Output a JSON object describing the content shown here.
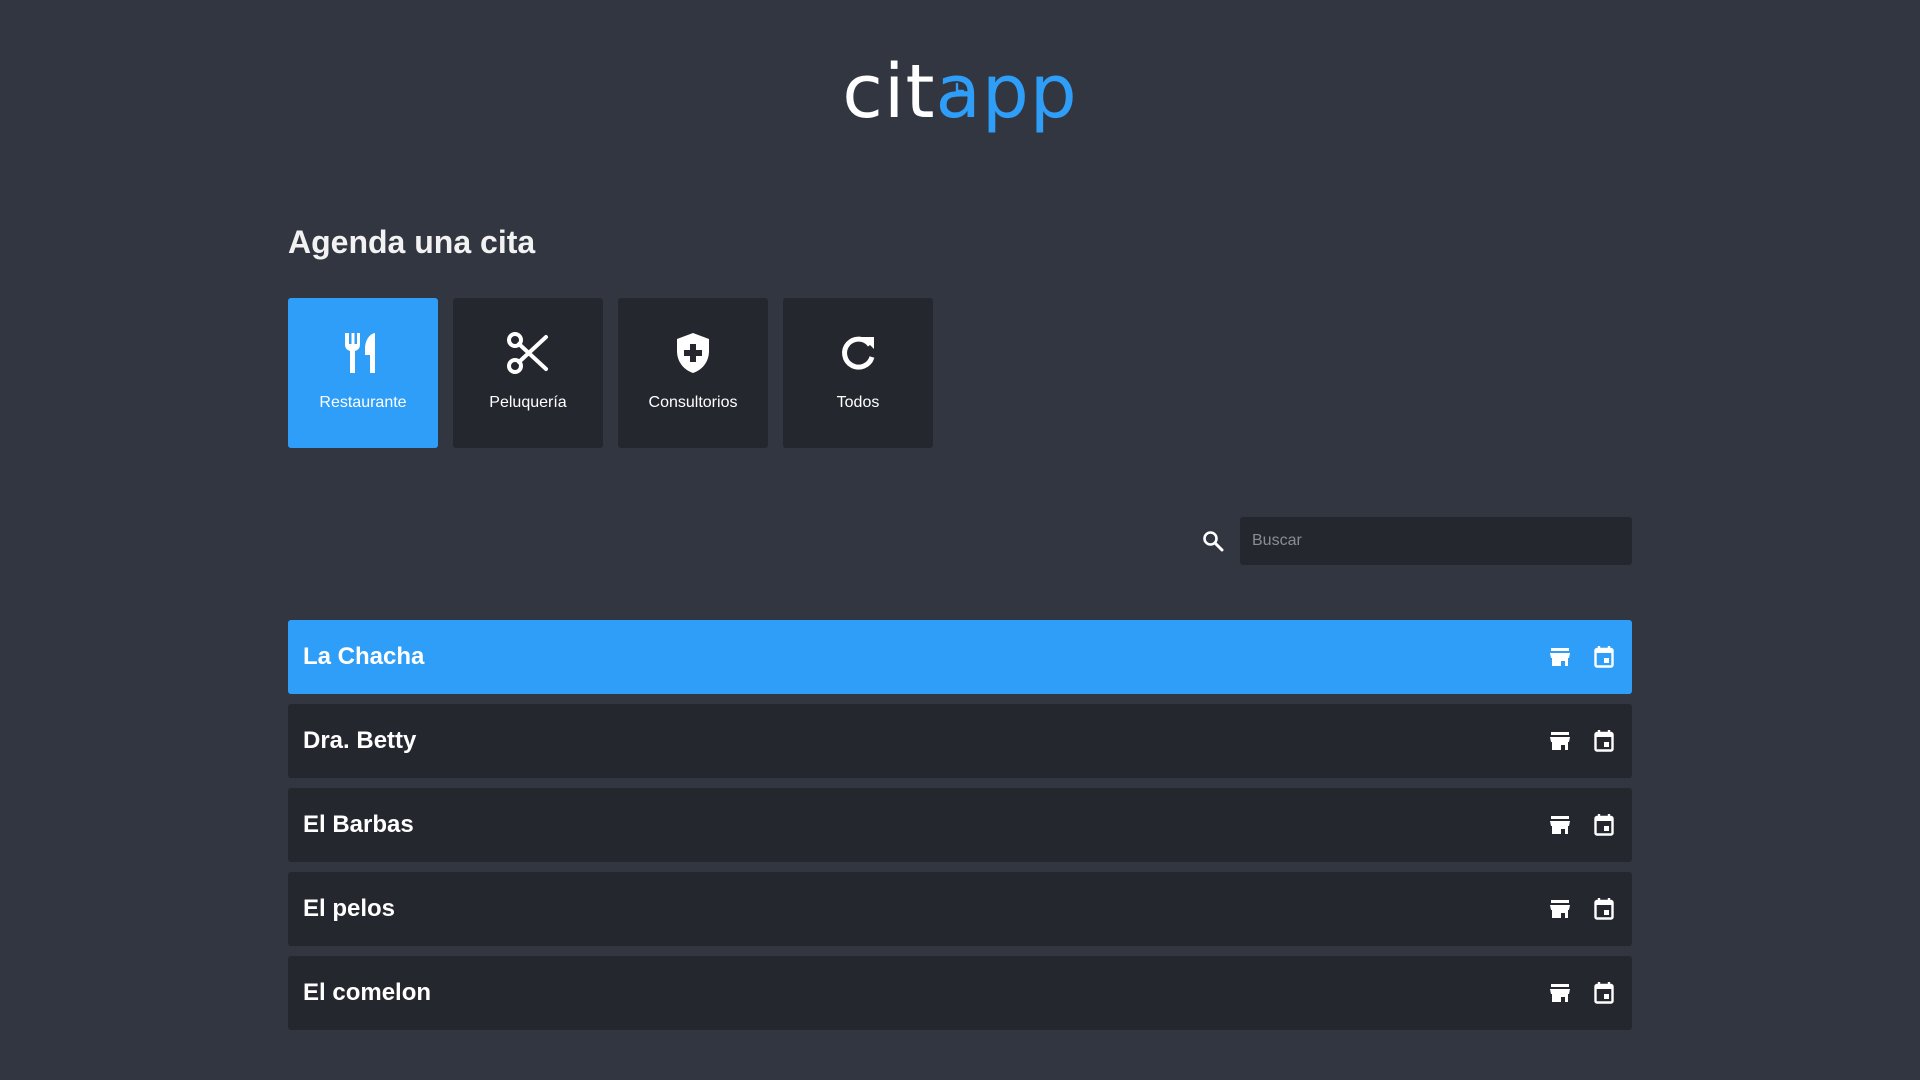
{
  "logo": {
    "part1": "cit",
    "part2": "app"
  },
  "heading": "Agenda una cita",
  "categories": [
    {
      "label": "Restaurante",
      "icon": "utensils-icon",
      "active": true
    },
    {
      "label": "Peluquería",
      "icon": "scissors-icon",
      "active": false
    },
    {
      "label": "Consultorios",
      "icon": "medical-shield-icon",
      "active": false
    },
    {
      "label": "Todos",
      "icon": "refresh-icon",
      "active": false
    }
  ],
  "search": {
    "placeholder": "Buscar",
    "value": ""
  },
  "businesses": [
    {
      "name": "La Chacha",
      "active": true
    },
    {
      "name": "Dra. Betty",
      "active": false
    },
    {
      "name": "El Barbas",
      "active": false
    },
    {
      "name": "El pelos",
      "active": false
    },
    {
      "name": "El comelon",
      "active": false
    }
  ],
  "colors": {
    "accent": "#2f9ef8",
    "background": "#323641",
    "card": "#25272e"
  }
}
